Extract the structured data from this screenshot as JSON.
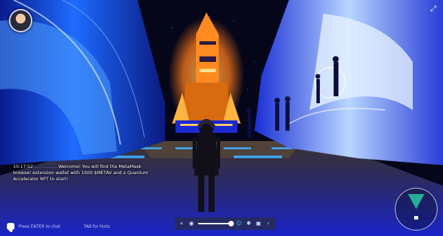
{
  "colors": {
    "sky": "#05061a",
    "tunnel_blue": "#2a3cff",
    "floor_blue": "#1b27c9",
    "rocket_orange": "#ff8a1f",
    "accent_cyan": "#40c4ff",
    "panel": "#282c46"
  },
  "chat": {
    "meta": "10:17:52",
    "name": "……………",
    "text": "Welcome! You will find the MetaMask browser extension wallet with 1000 $METAV and a Quantum Accelerator NFT to start!"
  },
  "hints": {
    "chat_hint": "Press ENTER to chat",
    "tab_hint": "TAB for hints"
  },
  "toolbar": {
    "volume_fraction": 0.8,
    "icons": [
      "chevrons-left-icon",
      "volume-icon",
      "emote-icon",
      "photo-icon",
      "gesture-icon",
      "back-icon"
    ]
  }
}
